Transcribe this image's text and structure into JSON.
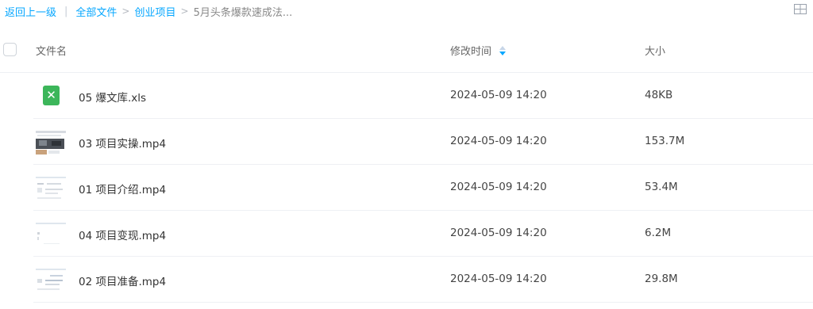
{
  "breadcrumb": {
    "back": "返回上一级",
    "items": [
      "全部文件",
      "创业项目",
      "5月头条爆款速成法..."
    ]
  },
  "table": {
    "headers": {
      "name": "文件名",
      "modified": "修改时间",
      "size": "大小"
    },
    "rows": [
      {
        "name": "05 爆文库.xls",
        "modified": "2024-05-09 14:20",
        "size": "48KB",
        "type": "xls"
      },
      {
        "name": "03 项目实操.mp4",
        "modified": "2024-05-09 14:20",
        "size": "153.7M",
        "type": "video"
      },
      {
        "name": "01 项目介绍.mp4",
        "modified": "2024-05-09 14:20",
        "size": "53.4M",
        "type": "video"
      },
      {
        "name": "04 项目变现.mp4",
        "modified": "2024-05-09 14:20",
        "size": "6.2M",
        "type": "video"
      },
      {
        "name": "02 项目准备.mp4",
        "modified": "2024-05-09 14:20",
        "size": "29.8M",
        "type": "video"
      }
    ]
  },
  "colors": {
    "accent": "#06a7ff",
    "xls": "#3cb65a",
    "divider": "#eef0f4"
  },
  "icons": {
    "grid": "grid-view-icon",
    "sort": "sort-arrows-icon",
    "xls": "excel-file-icon",
    "video": "video-thumbnail-icon"
  }
}
